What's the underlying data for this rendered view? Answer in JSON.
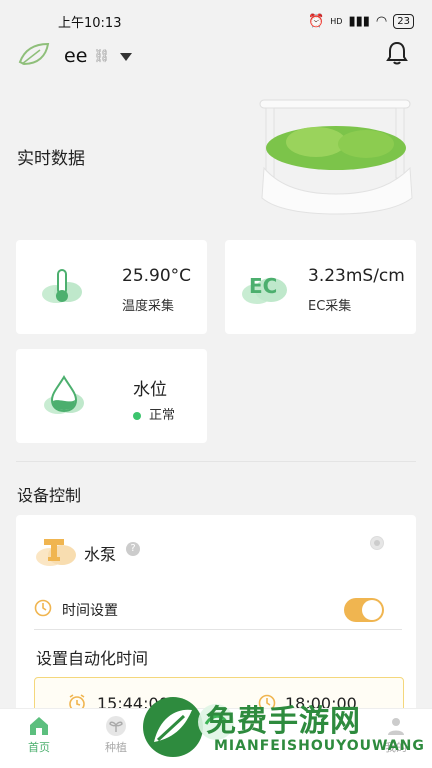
{
  "status_bar": {
    "time": "上午10:13",
    "signal_label": "HD",
    "battery": "23"
  },
  "header": {
    "device_name": "ee"
  },
  "realtime": {
    "title": "实时数据"
  },
  "metrics": {
    "temperature": {
      "value": "25.90°C",
      "label": "温度采集"
    },
    "ec": {
      "badge": "EC",
      "value": "3.23mS/cm",
      "label": "EC采集"
    },
    "water": {
      "title": "水位",
      "status": "正常"
    }
  },
  "control": {
    "title": "设备控制",
    "pump_label": "水泵",
    "time_setting_label": "时间设置",
    "time_setting_on": true,
    "auto_title": "设置自动化时间",
    "start_time": "15:44:00",
    "end_time": "18:00:00"
  },
  "tabs": [
    {
      "label": "首页"
    },
    {
      "label": "种植"
    },
    {
      "label": "我的"
    }
  ],
  "watermark": {
    "title": "免费手游网",
    "subtitle": "MIANFEISHOUYOUWANG"
  },
  "colors": {
    "accent_green": "#4caf6e",
    "toggle_orange": "#f0b550",
    "background": "#f2f2f2"
  }
}
